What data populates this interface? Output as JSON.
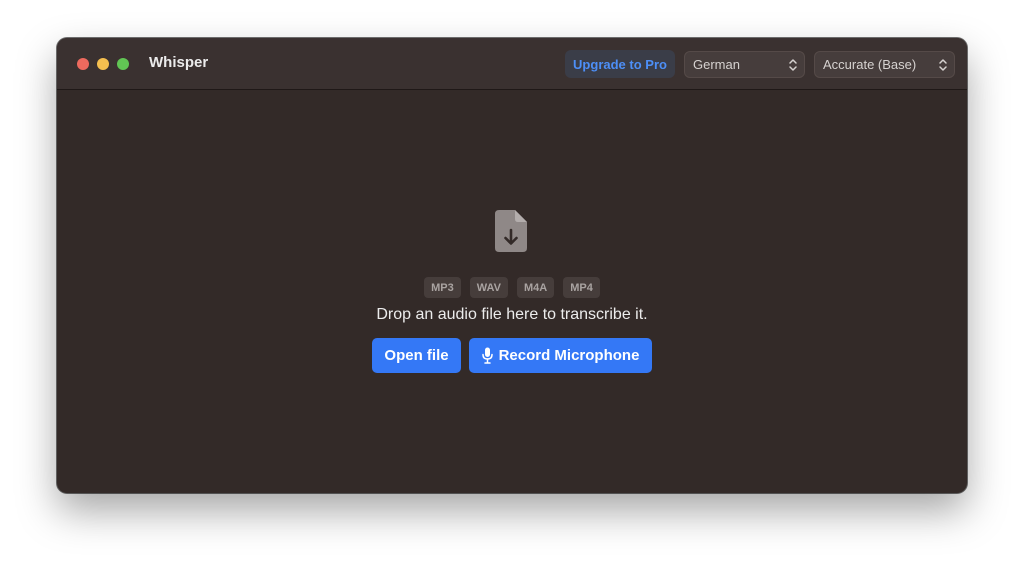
{
  "window": {
    "title": "Whisper"
  },
  "toolbar": {
    "upgrade_label": "Upgrade to Pro",
    "language_select": {
      "value": "German"
    },
    "model_select": {
      "value": "Accurate (Base)"
    }
  },
  "dropzone": {
    "icon": "file-download-icon",
    "formats": [
      "MP3",
      "WAV",
      "M4A",
      "MP4"
    ],
    "message": "Drop an audio file here to transcribe it.",
    "open_file_label": "Open file",
    "record_label": "Record Microphone",
    "record_icon": "microphone-icon"
  },
  "colors": {
    "window_bg": "#332a28",
    "titlebar_bg": "#3a3130",
    "accent": "#3478f6",
    "upgrade_text": "#4d8ff7",
    "traffic_close": "#ed6a5e",
    "traffic_minimize": "#f5bf4f",
    "traffic_maximize": "#61c554"
  }
}
